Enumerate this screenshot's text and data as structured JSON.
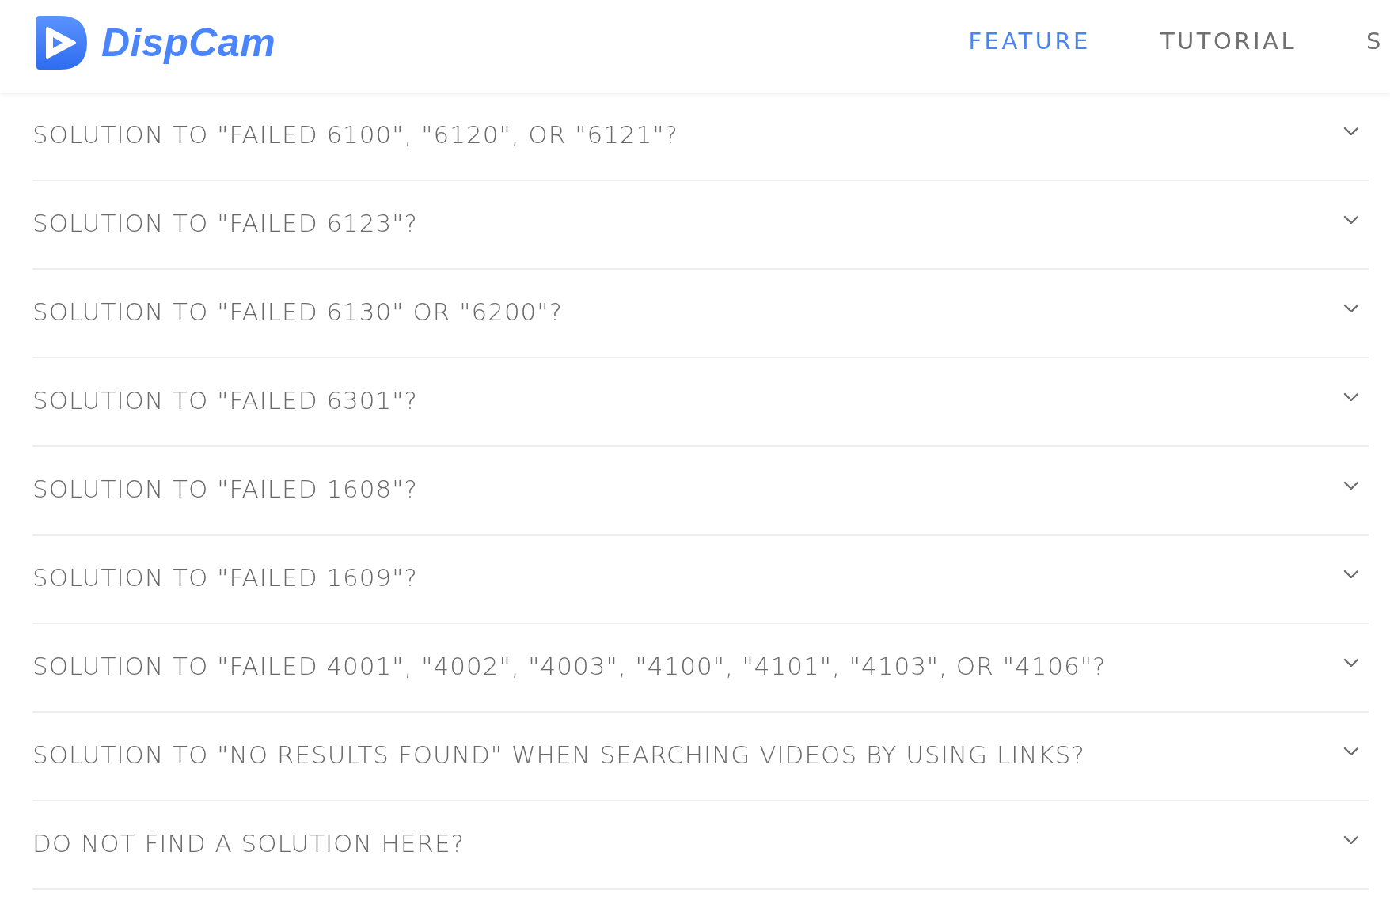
{
  "header": {
    "logo_text": "DispCam",
    "nav": [
      {
        "label": "FEATURE",
        "selected": true
      },
      {
        "label": "TUTORIAL",
        "selected": false
      },
      {
        "label": "S",
        "selected": false
      }
    ]
  },
  "faq": [
    {
      "question": "SOLUTION TO \"FAILED 6100\", \"6120\", OR \"6121\"?",
      "expanded": false
    },
    {
      "question": "SOLUTION TO \"FAILED 6123\"?",
      "expanded": false
    },
    {
      "question": "SOLUTION TO \"FAILED 6130\" OR \"6200\"?",
      "expanded": false
    },
    {
      "question": "SOLUTION TO \"FAILED 6301\"?",
      "expanded": false
    },
    {
      "question": "SOLUTION TO \"FAILED 1608\"?",
      "expanded": false
    },
    {
      "question": "SOLUTION TO \"FAILED 1609\"?",
      "expanded": false
    },
    {
      "question": "SOLUTION TO \"FAILED 4001\", \"4002\", \"4003\", \"4100\", \"4101\", \"4103\", OR \"4106\"?",
      "expanded": false
    },
    {
      "question": "SOLUTION TO \"NO RESULTS FOUND\" WHEN SEARCHING VIDEOS BY USING LINKS?",
      "expanded": false
    },
    {
      "question": "DO NOT FIND A SOLUTION HERE?",
      "expanded": false
    }
  ]
}
